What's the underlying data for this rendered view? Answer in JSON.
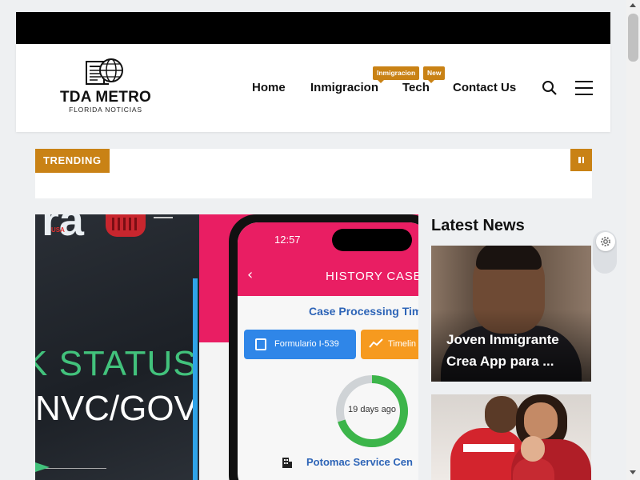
{
  "header": {
    "logo_title": "TDA METRO",
    "logo_subtitle": "FLORIDA NOTICIAS",
    "nav": [
      {
        "label": "Home"
      },
      {
        "label": "Inmigracion",
        "badge": "Inmigracion"
      },
      {
        "label": "Tech",
        "badge": "New"
      },
      {
        "label": "Contact Us"
      }
    ],
    "icons": {
      "search": "search-icon",
      "menu": "hamburger-menu-icon"
    }
  },
  "trending": {
    "label": "TRENDING",
    "pause_icon": "pause-icon"
  },
  "hero": {
    "partial_brand": "ra",
    "partial_usa": "USA",
    "status_text": "STATUS",
    "gov_text": "NVC/GOV",
    "phone": {
      "time": "12:57",
      "header": "HISTORY CASE",
      "subheader": "Case Processing Tim",
      "form_pill": "Formulario I-539",
      "timeline_pill": "Timelin",
      "donut_label": "19 days ago",
      "donut_fraction": 0.7,
      "service_center": "Potomac Service Cen"
    }
  },
  "latest_news": {
    "title": "Latest News",
    "cards": [
      {
        "title": "Joven Inmigrante Crea App para ..."
      },
      {
        "title": ""
      }
    ]
  },
  "colors": {
    "accent": "#c98215",
    "top_bar": "#000000",
    "hero_pink": "#e91e63",
    "status_green": "#42c27c",
    "link_blue": "#2d64b7"
  }
}
